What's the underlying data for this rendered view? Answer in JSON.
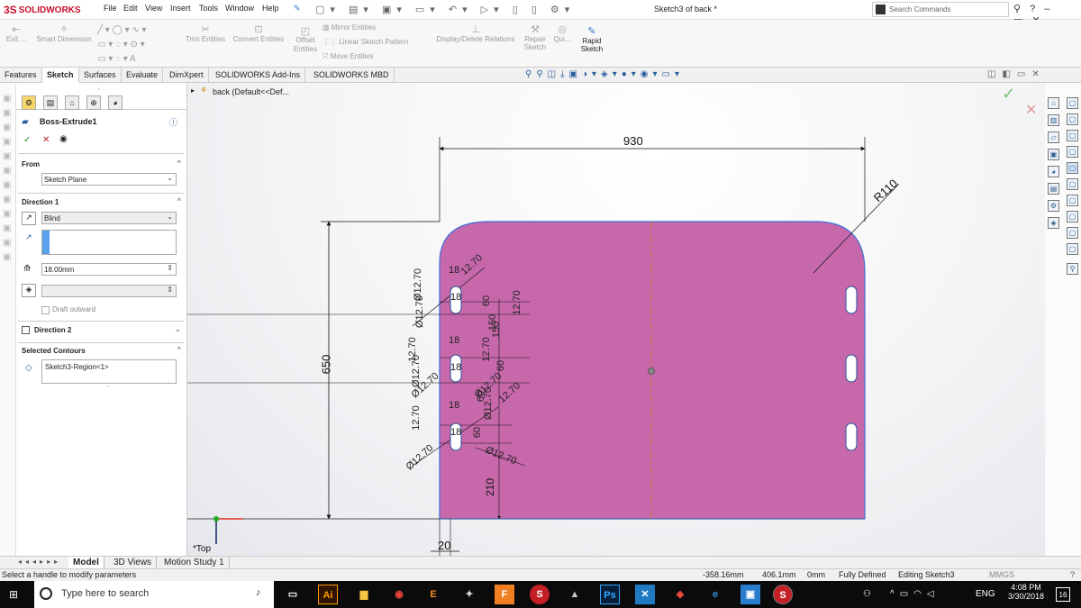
{
  "app": {
    "brand": "SOLIDWORKS",
    "doc_title": "Sketch3 of back *"
  },
  "menu": [
    "File",
    "Edit",
    "View",
    "Insert",
    "Tools",
    "Window",
    "Help"
  ],
  "search": {
    "placeholder": "Search Commands"
  },
  "ribbon": {
    "exit": "Exit ...",
    "smart_dimension": "Smart Dimension",
    "trim": "Trim Entities",
    "convert": "Convert Entities",
    "offset": "Offset Entities",
    "mirror": "Mirror Entities",
    "linear_pattern": "Linear Sketch Pattern",
    "move": "Move Entities",
    "display_delete": "Display/Delete Relations",
    "repair": "Repair Sketch",
    "quick": "Qui...",
    "rapid": "Rapid Sketch"
  },
  "cm_tabs": [
    "Features",
    "Sketch",
    "Surfaces",
    "Evaluate",
    "DimXpert",
    "SOLIDWORKS Add-Ins",
    "SOLIDWORKS MBD"
  ],
  "active_cm_tab": "Sketch",
  "property_manager": {
    "feature": "Boss-Extrude1",
    "from_label": "From",
    "from_value": "Sketch Plane",
    "direction1_label": "Direction 1",
    "end_condition": "Blind",
    "depth": "18.00mm",
    "draft_outward": "Draft outward",
    "direction2_label": "Direction 2",
    "selected_contours_label": "Selected Contours",
    "contour": "Sketch3-Region<1>"
  },
  "tree": {
    "item": "back (Default<<Def..."
  },
  "drawing": {
    "dim_width": "930",
    "dim_height": "650",
    "dim_radius": "R110",
    "dim_offset": "20",
    "dim_bottom": "210",
    "slot_labels": [
      "18",
      "Ø12.70",
      "12.70",
      "Ø12.70",
      "18",
      "60",
      "12.70",
      "18",
      "12.70",
      "Ø12.70",
      "12.70",
      "Ø12.70",
      "18",
      "60",
      "150",
      "60",
      "Ø12.70",
      "12.70",
      "18",
      "12.70",
      "Ø12.70",
      "Ø12.70",
      "18",
      "60",
      "Ø12.70",
      "150"
    ],
    "colors": {
      "plate": "#c768ab",
      "outline": "#3b6fd6",
      "dim": "#111111"
    },
    "view_label": "*Top"
  },
  "bottom_tabs": [
    "Model",
    "3D Views",
    "Motion Study 1"
  ],
  "active_bottom_tab": "Model",
  "status": {
    "message": "Select a handle to modify parameters",
    "x": "-358.16mm",
    "y": "406.1mm",
    "z": "0mm",
    "state": "Fully Defined",
    "editing": "Editing Sketch3",
    "units": "MMGS"
  },
  "taskbar": {
    "search_placeholder": "Type here to search",
    "lang": "ENG",
    "time": "4:08 PM",
    "date": "3/30/2018",
    "notif": "16"
  }
}
